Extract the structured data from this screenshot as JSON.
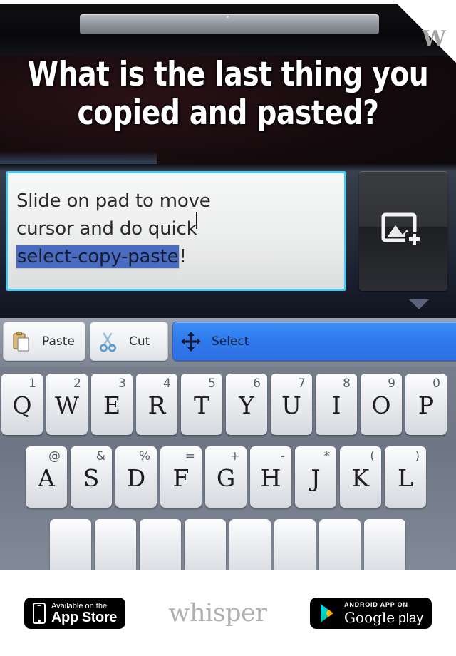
{
  "caption": {
    "line1": "What is the last thing you",
    "line2": "copied and pasted?"
  },
  "corner_badge": {
    "letter": "W",
    "icon": "whisper-corner-fold-icon"
  },
  "compose": {
    "text_before": "Slide on pad to move cursor and do quick ",
    "line1": "Slide on pad to move",
    "line2": "cursor and do quick",
    "selected_text": "select-copy-paste",
    "trailing_text": "!",
    "field_border_color": "#46c8f0",
    "selection_color": "#4a6cc0",
    "attach_icon": "add-image-icon"
  },
  "toolbar": {
    "paste_label": "Paste",
    "paste_icon": "clipboard-icon",
    "cut_label": "Cut",
    "cut_icon": "scissors-icon",
    "select_label": "Select",
    "select_icon": "move-arrows-icon",
    "active_color": "#2f7bee"
  },
  "keyboard": {
    "row1": [
      {
        "main": "Q",
        "alt": "1"
      },
      {
        "main": "W",
        "alt": "2"
      },
      {
        "main": "E",
        "alt": "3"
      },
      {
        "main": "R",
        "alt": "4"
      },
      {
        "main": "T",
        "alt": "5"
      },
      {
        "main": "Y",
        "alt": "6"
      },
      {
        "main": "U",
        "alt": "7"
      },
      {
        "main": "I",
        "alt": "8"
      },
      {
        "main": "O",
        "alt": "9"
      },
      {
        "main": "P",
        "alt": "0"
      }
    ],
    "row2": [
      {
        "main": "A",
        "alt": "@"
      },
      {
        "main": "S",
        "alt": "&"
      },
      {
        "main": "D",
        "alt": "%"
      },
      {
        "main": "F",
        "alt": "="
      },
      {
        "main": "G",
        "alt": "+"
      },
      {
        "main": "H",
        "alt": "-"
      },
      {
        "main": "J",
        "alt": "*"
      },
      {
        "main": "K",
        "alt": "("
      },
      {
        "main": "L",
        "alt": ")"
      }
    ],
    "row3": [
      {
        "main": "",
        "alt": ""
      },
      {
        "main": "",
        "alt": ""
      },
      {
        "main": "",
        "alt": ""
      },
      {
        "main": "",
        "alt": ""
      },
      {
        "main": "",
        "alt": ""
      },
      {
        "main": "",
        "alt": ""
      },
      {
        "main": "",
        "alt": ""
      },
      {
        "main": "",
        "alt": ""
      }
    ]
  },
  "footer": {
    "appstore": {
      "small": "Available on the",
      "big": "App Store",
      "icon": "iphone-icon"
    },
    "wordmark": "whisper",
    "googleplay": {
      "small": "ANDROID APP ON",
      "big": "Google",
      "big2": "play",
      "icon": "google-play-triangle-icon"
    }
  }
}
